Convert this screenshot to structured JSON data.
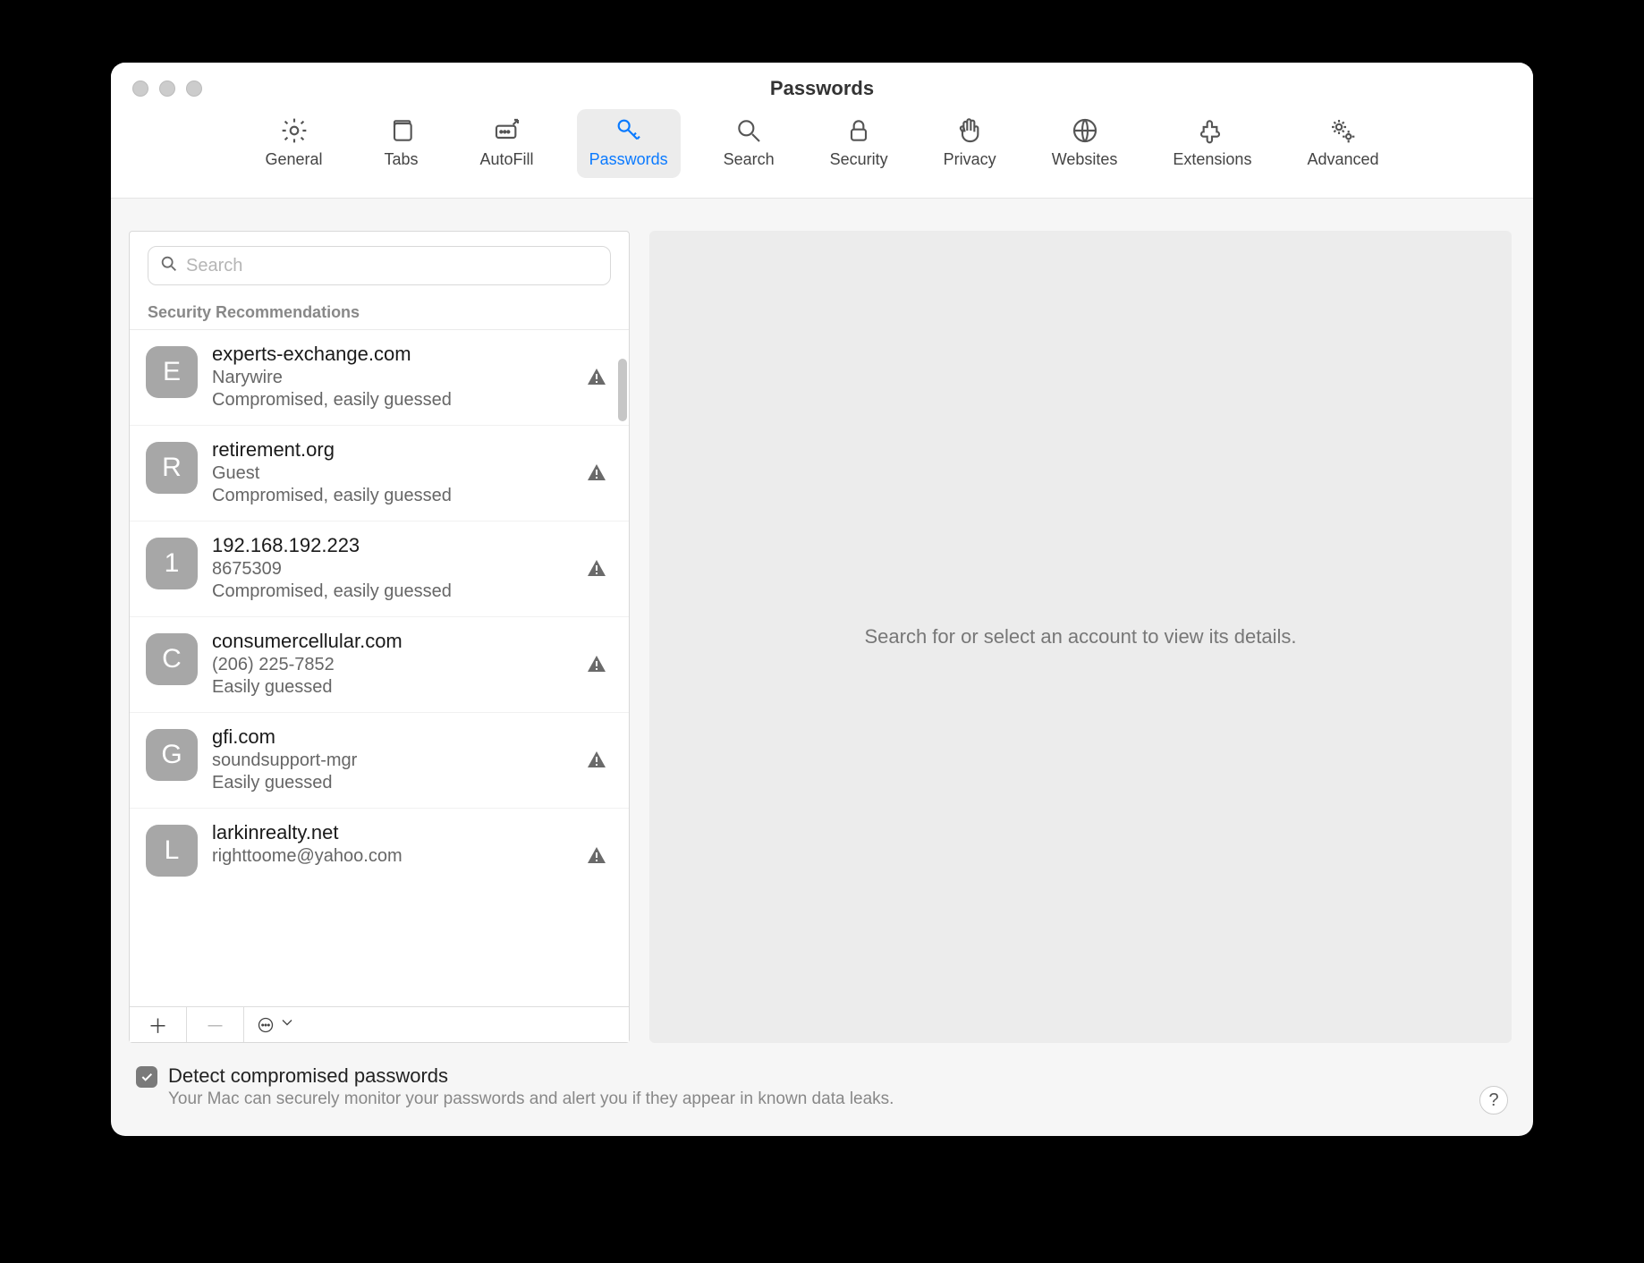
{
  "window": {
    "title": "Passwords"
  },
  "tabs": [
    {
      "id": "general",
      "label": "General"
    },
    {
      "id": "tabs",
      "label": "Tabs"
    },
    {
      "id": "autofill",
      "label": "AutoFill"
    },
    {
      "id": "passwords",
      "label": "Passwords",
      "active": true
    },
    {
      "id": "search",
      "label": "Search"
    },
    {
      "id": "security",
      "label": "Security"
    },
    {
      "id": "privacy",
      "label": "Privacy"
    },
    {
      "id": "websites",
      "label": "Websites"
    },
    {
      "id": "extensions",
      "label": "Extensions"
    },
    {
      "id": "advanced",
      "label": "Advanced"
    }
  ],
  "search": {
    "placeholder": "Search",
    "value": ""
  },
  "section_header": "Security Recommendations",
  "entries": [
    {
      "letter": "E",
      "site": "experts-exchange.com",
      "user": "Narywire",
      "risk": "Compromised, easily guessed"
    },
    {
      "letter": "R",
      "site": "retirement.org",
      "user": "Guest",
      "risk": "Compromised, easily guessed"
    },
    {
      "letter": "1",
      "site": "192.168.192.223",
      "user": "8675309",
      "risk": "Compromised, easily guessed"
    },
    {
      "letter": "C",
      "site": "consumercellular.com",
      "user": "(206) 225-7852",
      "risk": "Easily guessed"
    },
    {
      "letter": "G",
      "site": "gfi.com",
      "user": "soundsupport-mgr",
      "risk": "Easily guessed"
    },
    {
      "letter": "L",
      "site": "larkinrealty.net",
      "user": "righttoome@yahoo.com",
      "risk": ""
    }
  ],
  "detail_placeholder": "Search for or select an account to view its details.",
  "footer": {
    "checked": true,
    "title": "Detect compromised passwords",
    "description": "Your Mac can securely monitor your passwords and alert you if they appear in known data leaks."
  },
  "help_label": "?"
}
